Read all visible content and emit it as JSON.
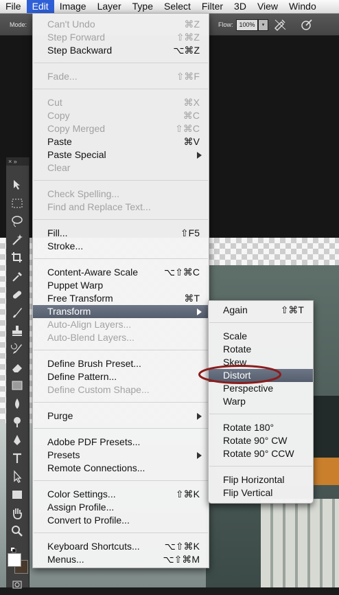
{
  "menubar": {
    "items": [
      "File",
      "Edit",
      "Image",
      "Layer",
      "Type",
      "Select",
      "Filter",
      "3D",
      "View",
      "Windo"
    ],
    "active": "Edit"
  },
  "options_bar": {
    "mode_label": "Mode:",
    "flow_label": "Flow:",
    "flow_value": "100%",
    "icons": [
      "airbrush-icon",
      "tablet-pressure-icon"
    ]
  },
  "edit_menu": {
    "items": [
      {
        "label": "Can't Undo",
        "shortcut": "⌘Z",
        "enabled": false
      },
      {
        "label": "Step Forward",
        "shortcut": "⇧⌘Z",
        "enabled": false
      },
      {
        "label": "Step Backward",
        "shortcut": "⌥⌘Z",
        "enabled": true
      },
      {
        "label": "Fade...",
        "shortcut": "⇧⌘F",
        "enabled": false
      },
      {
        "label": "Cut",
        "shortcut": "⌘X",
        "enabled": false
      },
      {
        "label": "Copy",
        "shortcut": "⌘C",
        "enabled": false
      },
      {
        "label": "Copy Merged",
        "shortcut": "⇧⌘C",
        "enabled": false
      },
      {
        "label": "Paste",
        "shortcut": "⌘V",
        "enabled": true
      },
      {
        "label": "Paste Special",
        "shortcut": "",
        "enabled": true,
        "submenu": true
      },
      {
        "label": "Clear",
        "shortcut": "",
        "enabled": false
      },
      {
        "label": "Check Spelling...",
        "shortcut": "",
        "enabled": false
      },
      {
        "label": "Find and Replace Text...",
        "shortcut": "",
        "enabled": false
      },
      {
        "label": "Fill...",
        "shortcut": "⇧F5",
        "enabled": true
      },
      {
        "label": "Stroke...",
        "shortcut": "",
        "enabled": true
      },
      {
        "label": "Content-Aware Scale",
        "shortcut": "⌥⇧⌘C",
        "enabled": true
      },
      {
        "label": "Puppet Warp",
        "shortcut": "",
        "enabled": true
      },
      {
        "label": "Free Transform",
        "shortcut": "⌘T",
        "enabled": true
      },
      {
        "label": "Transform",
        "shortcut": "",
        "enabled": true,
        "submenu": true,
        "highlighted": true
      },
      {
        "label": "Auto-Align Layers...",
        "shortcut": "",
        "enabled": false
      },
      {
        "label": "Auto-Blend Layers...",
        "shortcut": "",
        "enabled": false
      },
      {
        "label": "Define Brush Preset...",
        "shortcut": "",
        "enabled": true
      },
      {
        "label": "Define Pattern...",
        "shortcut": "",
        "enabled": true
      },
      {
        "label": "Define Custom Shape...",
        "shortcut": "",
        "enabled": false
      },
      {
        "label": "Purge",
        "shortcut": "",
        "enabled": true,
        "submenu": true
      },
      {
        "label": "Adobe PDF Presets...",
        "shortcut": "",
        "enabled": true
      },
      {
        "label": "Presets",
        "shortcut": "",
        "enabled": true,
        "submenu": true
      },
      {
        "label": "Remote Connections...",
        "shortcut": "",
        "enabled": true
      },
      {
        "label": "Color Settings...",
        "shortcut": "⇧⌘K",
        "enabled": true
      },
      {
        "label": "Assign Profile...",
        "shortcut": "",
        "enabled": true
      },
      {
        "label": "Convert to Profile...",
        "shortcut": "",
        "enabled": true
      },
      {
        "label": "Keyboard Shortcuts...",
        "shortcut": "⌥⇧⌘K",
        "enabled": true
      },
      {
        "label": "Menus...",
        "shortcut": "⌥⇧⌘M",
        "enabled": true
      }
    ]
  },
  "transform_menu": {
    "items": [
      {
        "label": "Again",
        "shortcut": "⇧⌘T"
      },
      {
        "label": "Scale",
        "shortcut": ""
      },
      {
        "label": "Rotate",
        "shortcut": ""
      },
      {
        "label": "Skew",
        "shortcut": ""
      },
      {
        "label": "Distort",
        "shortcut": "",
        "highlighted": true
      },
      {
        "label": "Perspective",
        "shortcut": ""
      },
      {
        "label": "Warp",
        "shortcut": ""
      },
      {
        "label": "Rotate 180°",
        "shortcut": ""
      },
      {
        "label": "Rotate 90° CW",
        "shortcut": ""
      },
      {
        "label": "Rotate 90° CCW",
        "shortcut": ""
      },
      {
        "label": "Flip Horizontal",
        "shortcut": ""
      },
      {
        "label": "Flip Vertical",
        "shortcut": ""
      }
    ]
  },
  "toolbar": {
    "header": "× »",
    "tools": [
      "move-tool-icon",
      "marquee-tool-icon",
      "lasso-tool-icon",
      "magic-wand-icon",
      "crop-tool-icon",
      "eyedropper-icon",
      "healing-brush-icon",
      "brush-tool-icon",
      "clone-stamp-icon",
      "history-brush-icon",
      "eraser-icon",
      "gradient-tool-icon",
      "blur-tool-icon",
      "dodge-tool-icon",
      "pen-tool-icon",
      "type-tool-icon",
      "path-selection-icon",
      "rectangle-tool-icon",
      "hand-tool-icon",
      "zoom-tool-icon"
    ]
  },
  "colors": {
    "menu_highlight": "#5b6474",
    "menubar_active": "#2f5fd6",
    "annotation_ellipse": "#8c1c1c"
  }
}
